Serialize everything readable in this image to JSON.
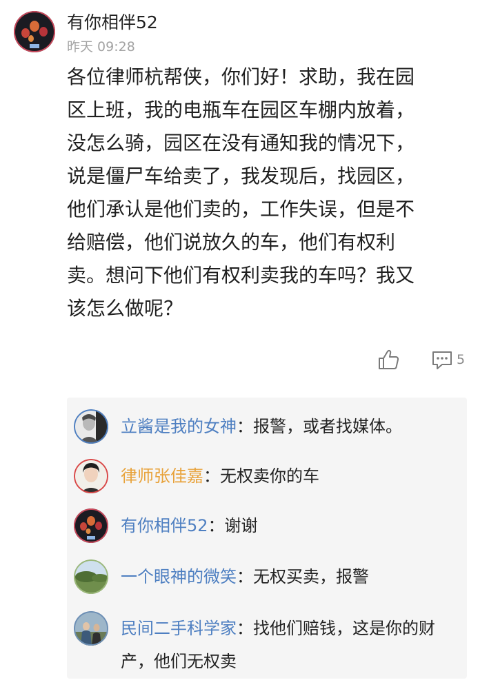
{
  "post": {
    "author": "有你相伴52",
    "time": "昨天 09:28",
    "body_lines": [
      "各位律师杭帮侠，你们好！求助，我在园",
      "区上班，我的电瓶车在园区车棚内放着，",
      "没怎么骑，园区在没有通知我的情况下，",
      "说是僵尸车给卖了，我发现后，找园区，",
      "他们承认是他们卖的，工作失误，但是不",
      "给赔偿，他们说放久的车，他们有权利",
      "卖。想问下他们有权利卖我的车吗？我又",
      "该怎么做呢？"
    ],
    "like_icon": "thumbs-up-icon",
    "comment_icon": "comment-icon",
    "comment_count": "5"
  },
  "replies": [
    {
      "user": "立酱是我的女神",
      "separator": "：",
      "text": "报警，或者找媒体。"
    },
    {
      "user": "律师张佳嘉",
      "separator": "：",
      "text": "无权卖你的车"
    },
    {
      "user": "有你相伴52",
      "separator": "：",
      "text": "谢谢"
    },
    {
      "user": "一个眼神的微笑",
      "separator": "：",
      "text": "无权买卖，报警"
    },
    {
      "user": "民间二手科学家",
      "separator": "：",
      "text": "找他们赔钱，这是你的财产，他们无权卖"
    }
  ],
  "colors": {
    "username_blue": "#4e7fc1",
    "lawyer_orange": "#e8a23a",
    "reply_background": "#f5f5f5",
    "timestamp_gray": "#a3a3a3"
  }
}
